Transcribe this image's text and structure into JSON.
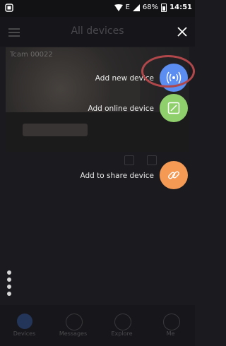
{
  "status_bar": {
    "battery": "68%",
    "time": "14:51",
    "network": "E"
  },
  "topbar": {
    "title": "All devices"
  },
  "preview": {
    "camera_label": "Tcam 00022"
  },
  "fab_menu": {
    "items": [
      {
        "label": "Add new device",
        "icon": "radio-waves-icon",
        "color": "#5c8df0"
      },
      {
        "label": "Add online device",
        "icon": "checkbox-slash-icon",
        "color": "#8fd06c"
      },
      {
        "label": "Add to share device",
        "icon": "link-icon",
        "color": "#f49a55"
      }
    ]
  },
  "bottom_nav": {
    "items": [
      {
        "label": "Devices"
      },
      {
        "label": "Messages"
      },
      {
        "label": "Explore"
      },
      {
        "label": "Me"
      }
    ]
  },
  "colors": {
    "highlight_ring": "#b0474a",
    "background": "#1b1b1f"
  }
}
